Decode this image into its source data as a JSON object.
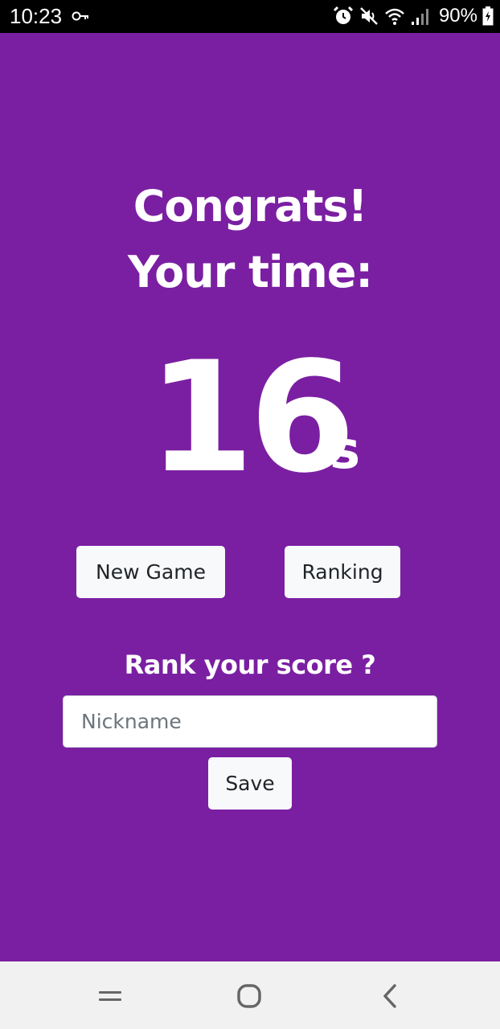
{
  "status_bar": {
    "time": "10:23",
    "battery_text": "90%",
    "icons": [
      "vpn-key-icon",
      "alarm-icon",
      "mute-icon",
      "wifi-icon",
      "signal-icon",
      "battery-charging-icon"
    ]
  },
  "result": {
    "congrats": "Congrats!",
    "your_time": "Your time:",
    "time_value": "16",
    "time_unit": "s"
  },
  "actions": {
    "new_game_label": "New Game",
    "ranking_label": "Ranking"
  },
  "rank_form": {
    "prompt": "Rank your score ?",
    "nickname_placeholder": "Nickname",
    "nickname_value": "",
    "save_label": "Save"
  },
  "nav_bar": {
    "icons": [
      "recent-apps-icon",
      "home-icon",
      "back-icon"
    ]
  },
  "colors": {
    "background": "#7a1fa2",
    "button_bg": "#f8f9fa",
    "text": "#ffffff"
  }
}
